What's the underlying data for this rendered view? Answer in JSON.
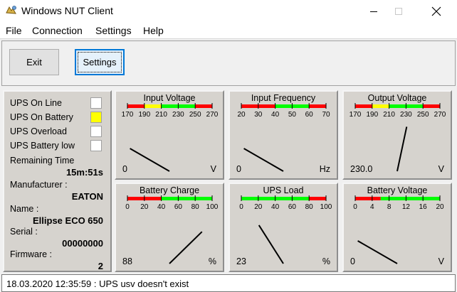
{
  "window": {
    "title": "Windows NUT Client"
  },
  "menu": {
    "file": "File",
    "connection": "Connection",
    "settings": "Settings",
    "help": "Help"
  },
  "toolbar": {
    "exit_label": "Exit",
    "settings_label": "Settings"
  },
  "status": {
    "online_label": "UPS On Line",
    "on_battery_label": "UPS On Battery",
    "overload_label": "UPS Overload",
    "battery_low_label": "UPS Battery low",
    "remaining_label": "Remaining Time",
    "remaining_value": "15m:51s",
    "manufacturer_label": "Manufacturer :",
    "manufacturer_value": "EATON",
    "name_label": "Name :",
    "name_value": "Ellipse ECO 650",
    "serial_label": "Serial :",
    "serial_value": "00000000",
    "firmware_label": "Firmware :",
    "firmware_value": "2",
    "indicator_on_battery_color": "#ffff00"
  },
  "gauges": [
    {
      "title": "Input Voltage",
      "ticks": [
        "170",
        "190",
        "210",
        "230",
        "250",
        "270"
      ],
      "min": 170,
      "max": 270,
      "value": 0,
      "value_text": "0",
      "unit": "V",
      "zones": [
        {
          "from": 170,
          "to": 190,
          "color": "#ff0000"
        },
        {
          "from": 190,
          "to": 210,
          "color": "#ffff00"
        },
        {
          "from": 210,
          "to": 250,
          "color": "#00ff00"
        },
        {
          "from": 250,
          "to": 270,
          "color": "#ff0000"
        }
      ]
    },
    {
      "title": "Input Frequency",
      "ticks": [
        "20",
        "30",
        "40",
        "50",
        "60",
        "70"
      ],
      "min": 20,
      "max": 70,
      "value": 0,
      "value_text": "0",
      "unit": "Hz",
      "zones": [
        {
          "from": 20,
          "to": 40,
          "color": "#ff0000"
        },
        {
          "from": 40,
          "to": 60,
          "color": "#00ff00"
        },
        {
          "from": 60,
          "to": 70,
          "color": "#ff0000"
        }
      ]
    },
    {
      "title": "Output Voltage",
      "ticks": [
        "170",
        "190",
        "210",
        "230",
        "250",
        "270"
      ],
      "min": 170,
      "max": 270,
      "value": 230,
      "value_text": "230.0",
      "unit": "V",
      "zones": [
        {
          "from": 170,
          "to": 190,
          "color": "#ff0000"
        },
        {
          "from": 190,
          "to": 210,
          "color": "#ffff00"
        },
        {
          "from": 210,
          "to": 250,
          "color": "#00ff00"
        },
        {
          "from": 250,
          "to": 270,
          "color": "#ff0000"
        }
      ]
    },
    {
      "title": "Battery Charge",
      "ticks": [
        "0",
        "20",
        "40",
        "60",
        "80",
        "100"
      ],
      "min": 0,
      "max": 100,
      "value": 88,
      "value_text": "88",
      "unit": "%",
      "zones": [
        {
          "from": 0,
          "to": 40,
          "color": "#ff0000"
        },
        {
          "from": 40,
          "to": 100,
          "color": "#00ff00"
        }
      ]
    },
    {
      "title": "UPS Load",
      "ticks": [
        "0",
        "20",
        "40",
        "60",
        "80",
        "100"
      ],
      "min": 0,
      "max": 100,
      "value": 23,
      "value_text": "23",
      "unit": "%",
      "zones": [
        {
          "from": 0,
          "to": 80,
          "color": "#00ff00"
        },
        {
          "from": 80,
          "to": 100,
          "color": "#ff0000"
        }
      ]
    },
    {
      "title": "Battery Voltage",
      "ticks": [
        "0",
        "4",
        "8",
        "12",
        "16",
        "20"
      ],
      "min": 0,
      "max": 20,
      "value": 0,
      "value_text": "0",
      "unit": "V",
      "zones": [
        {
          "from": 0,
          "to": 6,
          "color": "#ff0000"
        },
        {
          "from": 6,
          "to": 20,
          "color": "#00ff00"
        }
      ]
    }
  ],
  "log": {
    "text": "18.03.2020 12:35:59 : UPS usv doesn't exist"
  }
}
